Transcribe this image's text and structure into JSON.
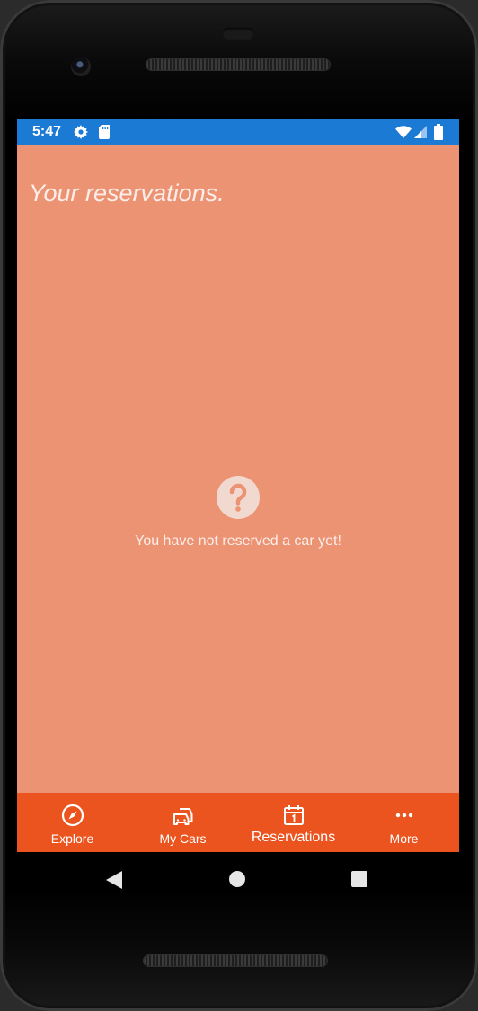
{
  "status_bar": {
    "time": "5:47",
    "icons": [
      "gear-icon",
      "sd-card-icon",
      "wifi-icon",
      "signal-icon",
      "battery-icon"
    ],
    "background": "#1a7ad4"
  },
  "page": {
    "title": "Your reservations.",
    "background": "#ec9374"
  },
  "empty_state": {
    "icon": "question-icon",
    "message": "You have not reserved a car yet!"
  },
  "tab_bar": {
    "background": "#eb541f",
    "active_tab": "Reservations",
    "tabs": [
      {
        "label": "Explore",
        "icon": "compass-icon"
      },
      {
        "label": "My Cars",
        "icon": "cars-icon"
      },
      {
        "label": "Reservations",
        "icon": "calendar-icon"
      },
      {
        "label": "More",
        "icon": "more-dots-icon"
      }
    ]
  },
  "system_nav": {
    "buttons": [
      "back-icon",
      "home-icon",
      "recents-icon"
    ]
  }
}
